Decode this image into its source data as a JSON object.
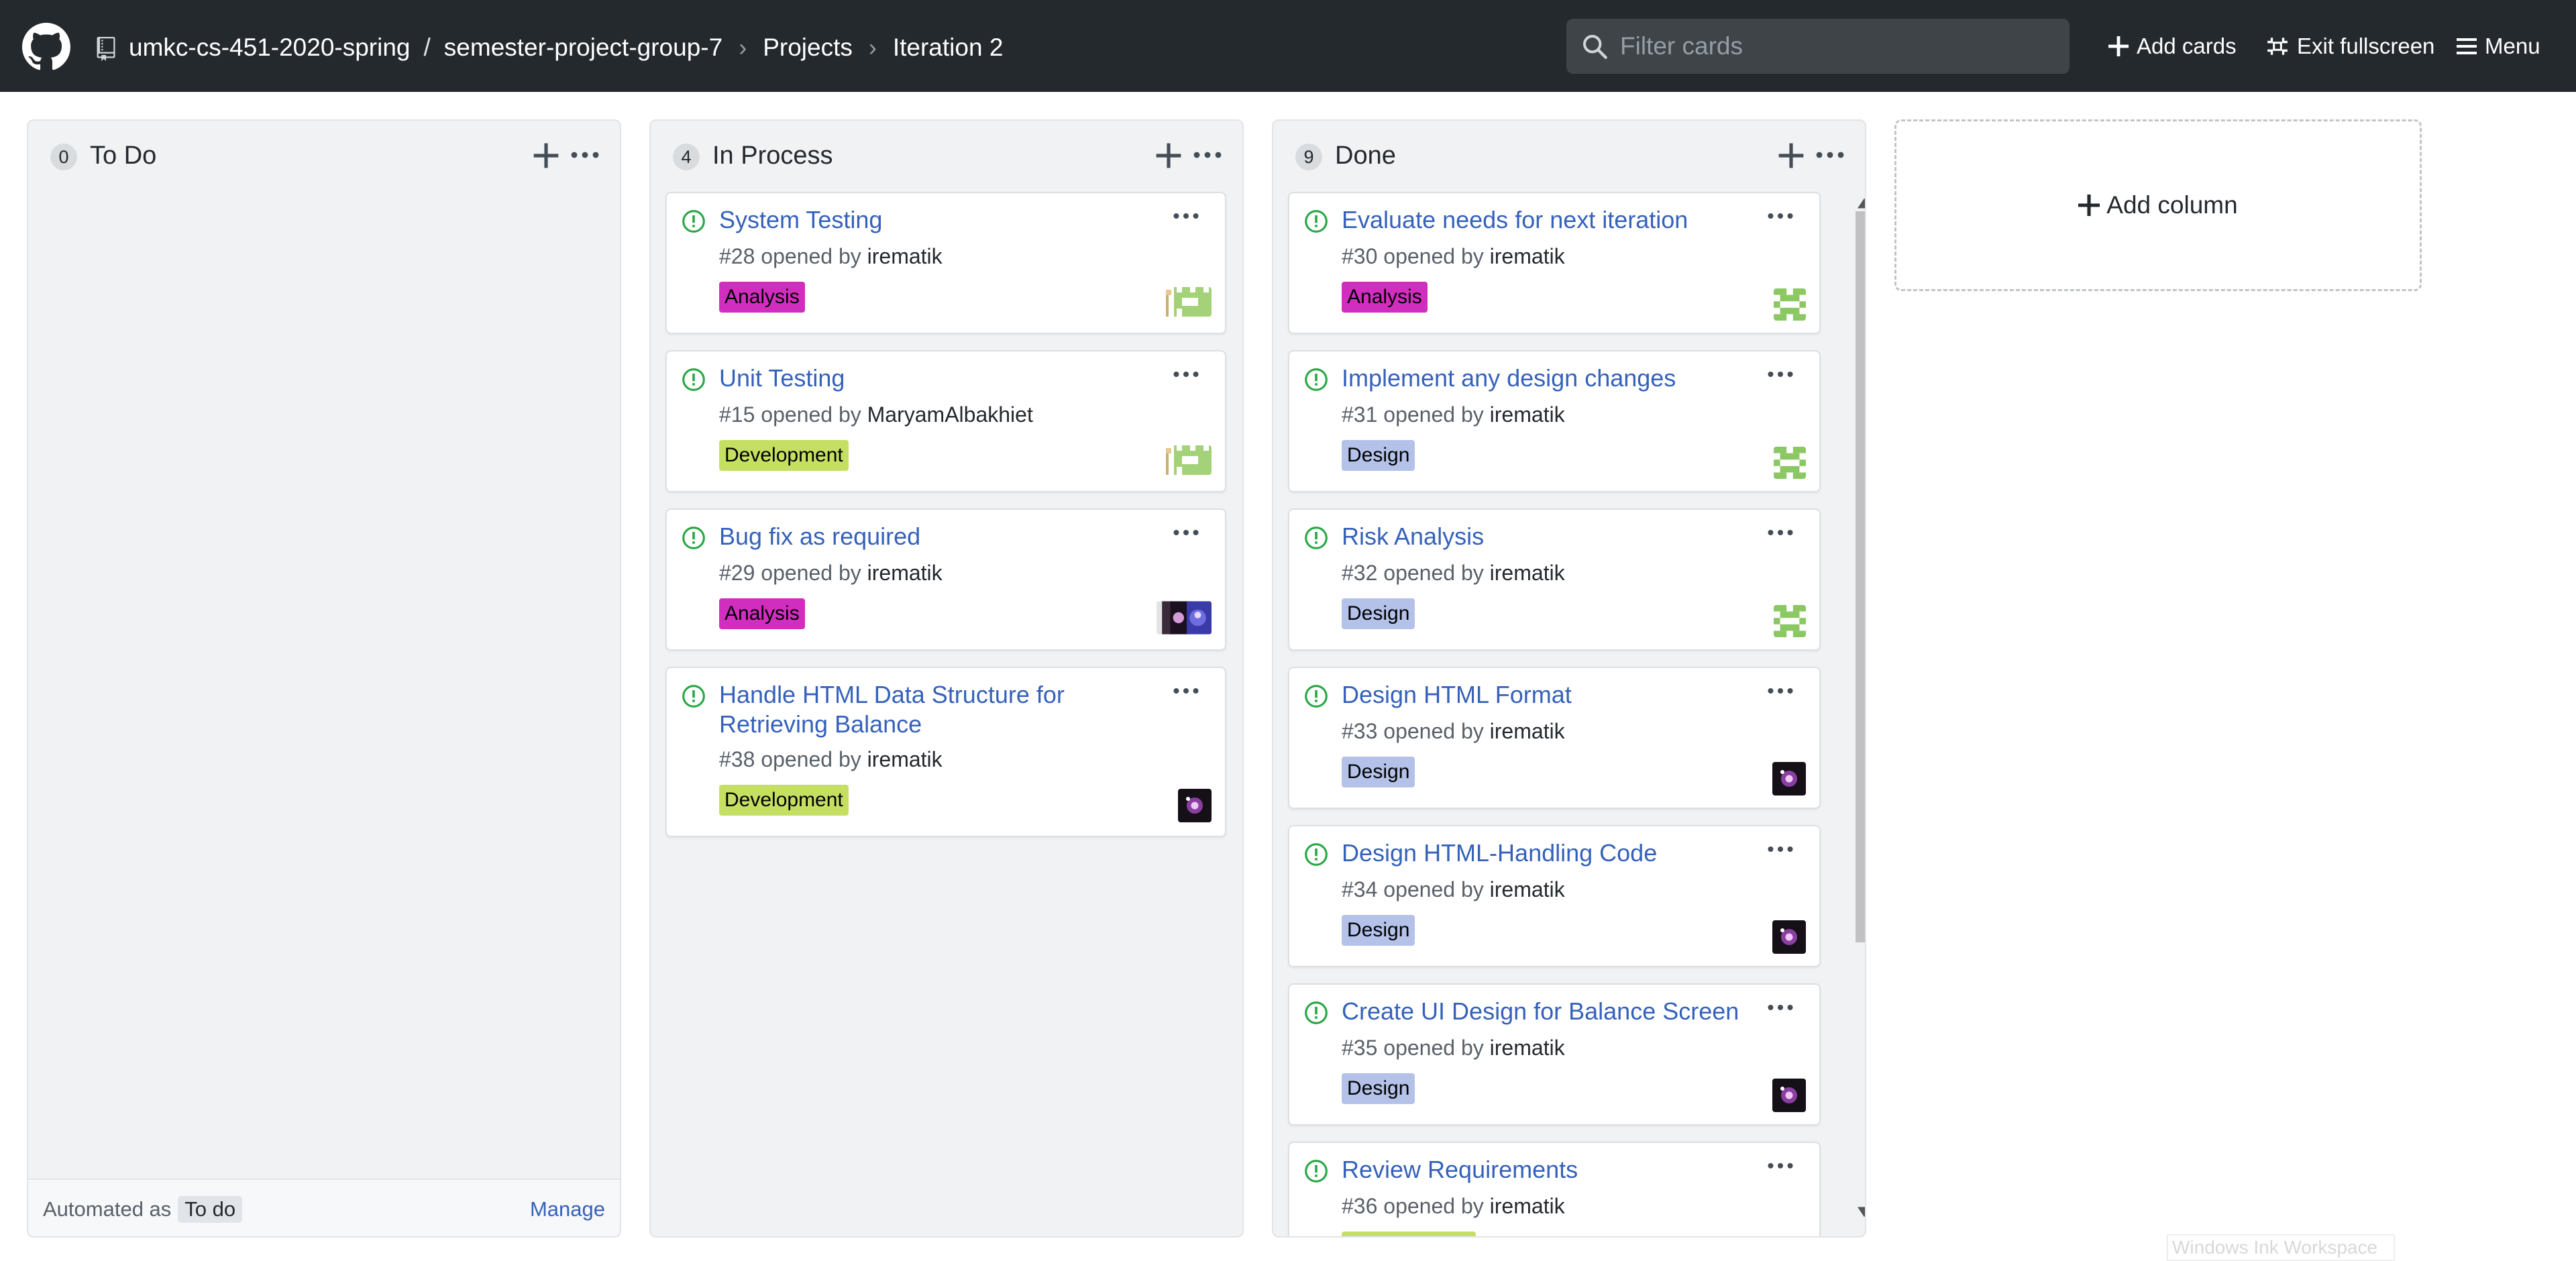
{
  "header": {
    "breadcrumbs": [
      "umkc-cs-451-2020-spring",
      "/",
      "semester-project-group-7",
      "Projects",
      "Iteration 2"
    ],
    "filter_placeholder": "Filter cards",
    "add_cards": "Add cards",
    "exit_fullscreen": "Exit fullscreen",
    "menu": "Menu"
  },
  "columns": [
    {
      "count": "0",
      "title": "To Do",
      "cards": [],
      "footer": {
        "automated_as": "Automated as",
        "automation_tag": "To do",
        "manage": "Manage"
      }
    },
    {
      "count": "4",
      "title": "In Process",
      "cards": [
        {
          "title": "System Testing",
          "meta": "#28 opened by",
          "user": "irematik",
          "label": "Analysis"
        },
        {
          "title": "Unit Testing",
          "meta": "#15 opened by",
          "user": "MaryamAlbakhiet",
          "label": "Development"
        },
        {
          "title": "Bug fix as required",
          "meta": "#29 opened by",
          "user": "irematik",
          "label": "Analysis"
        },
        {
          "title": "Handle HTML Data Structure for Retrieving Balance",
          "meta": "#38 opened by",
          "user": "irematik",
          "label": "Development"
        }
      ]
    },
    {
      "count": "9",
      "title": "Done",
      "cards": [
        {
          "title": "Evaluate needs for next iteration",
          "meta": "#30 opened by",
          "user": "irematik",
          "label": "Analysis"
        },
        {
          "title": "Implement any design changes",
          "meta": "#31 opened by",
          "user": "irematik",
          "label": "Design"
        },
        {
          "title": "Risk Analysis",
          "meta": "#32 opened by",
          "user": "irematik",
          "label": "Design"
        },
        {
          "title": "Design HTML Format",
          "meta": "#33 opened by",
          "user": "irematik",
          "label": "Design"
        },
        {
          "title": "Design HTML-Handling Code",
          "meta": "#34 opened by",
          "user": "irematik",
          "label": "Design"
        },
        {
          "title": "Create UI Design for Balance Screen",
          "meta": "#35 opened by",
          "user": "irematik",
          "label": "Design"
        },
        {
          "title": "Review Requirements",
          "meta": "#36 opened by",
          "user": "irematik",
          "label": ""
        }
      ]
    }
  ],
  "add_column": "Add column",
  "label_colors": {
    "Analysis": "#d12ec0",
    "Development": "#c5df62",
    "Design": "#b4c2ea"
  },
  "watermark": "Windows Ink Workspace"
}
